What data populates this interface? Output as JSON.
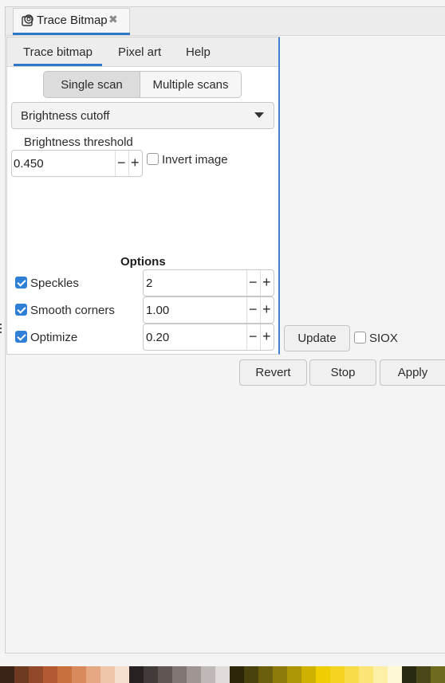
{
  "doc_tab": {
    "label": "Trace Bitmap",
    "icon": "trace-bitmap-icon",
    "close_icon": "close-icon"
  },
  "subtabs": [
    "Trace bitmap",
    "Pixel art",
    "Help"
  ],
  "mode": {
    "single": "Single scan",
    "multiple": "Multiple scans",
    "selected": "Single scan"
  },
  "dropdown": {
    "value": "Brightness cutoff"
  },
  "threshold": {
    "label": "Brightness threshold",
    "value": "0.450",
    "minus": "−",
    "plus": "+"
  },
  "invert": {
    "label": "Invert image",
    "checked": false
  },
  "options": {
    "heading": "Options",
    "speckles": {
      "label": "Speckles",
      "value": "2",
      "checked": true
    },
    "smooth": {
      "label": "Smooth corners",
      "value": "1.00",
      "checked": true
    },
    "optimize": {
      "label": "Optimize",
      "value": "0.20",
      "checked": true
    }
  },
  "update_button": "Update",
  "siox": {
    "label": "SIOX",
    "checked": false
  },
  "buttons": {
    "revert": "Revert",
    "stop": "Stop",
    "apply": "Apply"
  },
  "colors": {
    "accent": "#2f78c8"
  },
  "palette": [
    "#3b2318",
    "#6e3a22",
    "#92492a",
    "#b45a32",
    "#c9703f",
    "#d98a5c",
    "#e6a883",
    "#efc6ab",
    "#f5e0d0",
    "#272221",
    "#423b39",
    "#5f5654",
    "#7f7573",
    "#9f9694",
    "#bfb8b6",
    "#e0dbd9",
    "#2b2708",
    "#4a420c",
    "#6b5e0c",
    "#8c7a0a",
    "#ad9506",
    "#cfb102",
    "#f0cd00",
    "#f5d421",
    "#f8dc4a",
    "#fbe576",
    "#fdefa6",
    "#fff8d6",
    "#2a2a12",
    "#4a4818",
    "#6e6a1e"
  ]
}
